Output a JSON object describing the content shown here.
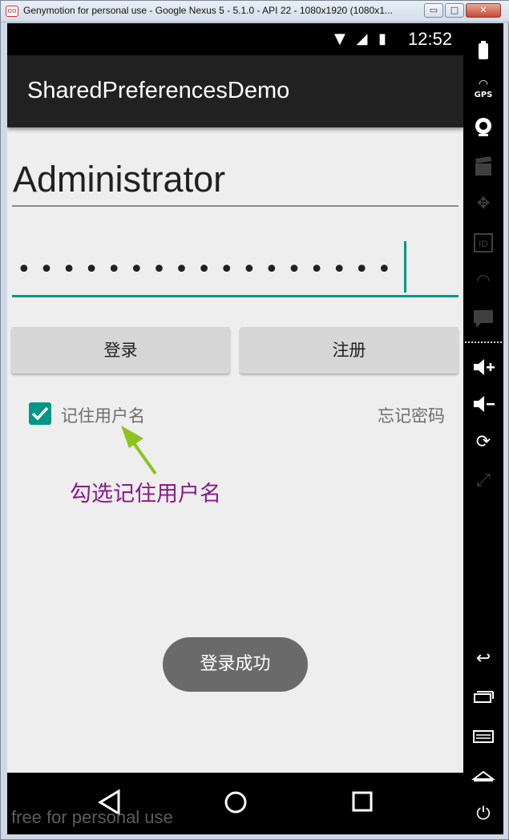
{
  "window": {
    "title": "Genymotion for personal use - Google Nexus 5 - 5.1.0 - API 22 - 1080x1920 (1080x1...",
    "app_icon": "oo",
    "min_label": "▭",
    "max_label": "□",
    "close_label": "✕"
  },
  "status_bar": {
    "icons": "▼ ◢ ▮",
    "time": "12:52"
  },
  "action_bar": {
    "title": "SharedPreferencesDemo"
  },
  "form": {
    "username_value": "Administrator",
    "password_masked": "•••••••••••••••••",
    "login_button": "登录",
    "register_button": "注册",
    "remember_checked": true,
    "remember_label": "记住用户名",
    "forgot_label": "忘记密码"
  },
  "annotation": {
    "text": "勾选记住用户名",
    "color": "#8a1a8a",
    "arrow_color": "#8dc21f"
  },
  "toast": {
    "text": "登录成功"
  },
  "watermark": "free for personal use",
  "accent_color": "#009688",
  "side_panel_icons": [
    "battery-icon",
    "gps-icon",
    "webcam-icon",
    "clapper-icon",
    "move-icon",
    "id-icon",
    "rss-icon",
    "message-icon",
    "volume-up-icon",
    "volume-down-icon",
    "rotate-icon",
    "fullscreen-icon",
    "back-icon",
    "recent-apps-icon",
    "menu-icon",
    "home-icon",
    "power-icon"
  ],
  "side_panel_gps_label": "GPS",
  "side_panel_id_label": "ID"
}
